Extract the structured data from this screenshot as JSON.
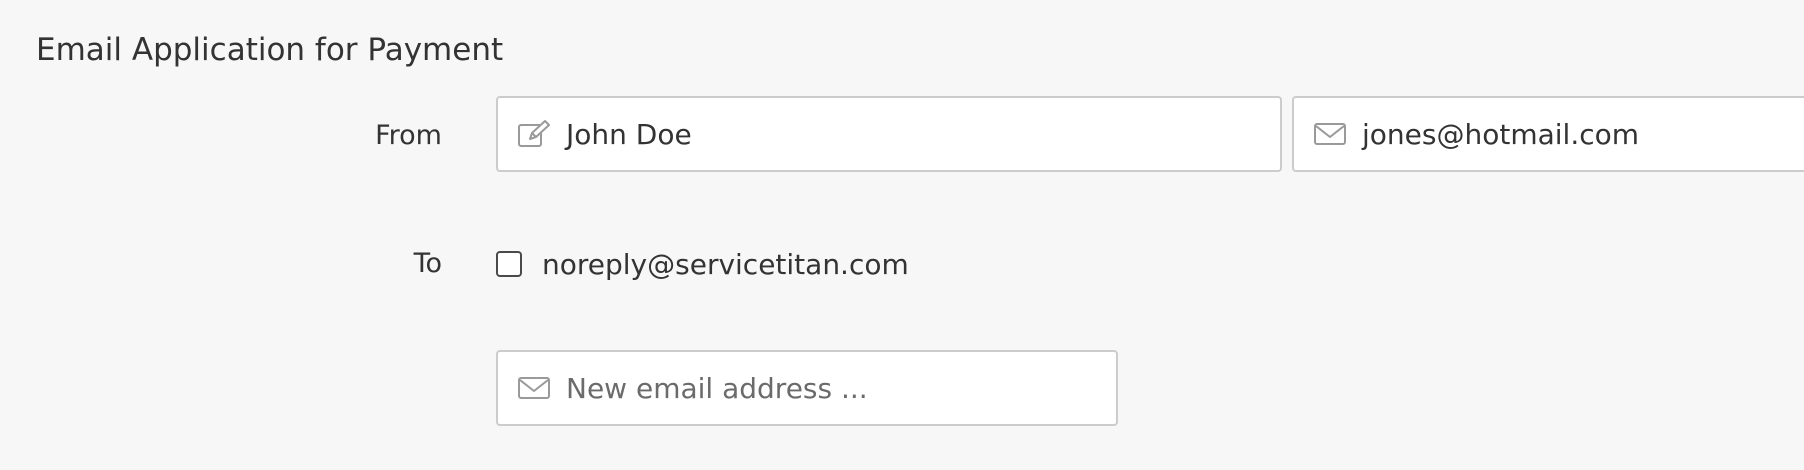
{
  "form": {
    "title": "Email Application for Payment",
    "from": {
      "label": "From",
      "name_value": "John Doe",
      "name_icon": "edit-icon",
      "email_value": "jones@hotmail.com",
      "email_icon": "envelope-icon"
    },
    "to": {
      "label": "To",
      "recipients": [
        {
          "address": "noreply@servicetitan.com",
          "checked": false
        }
      ],
      "new_email_placeholder": "New email address ...",
      "new_email_icon": "envelope-icon"
    }
  },
  "colors": {
    "background": "#f7f7f7",
    "field_border": "#cccccc",
    "icon": "#9a9a9a",
    "text": "#333333",
    "placeholder": "#6b6b6b"
  }
}
